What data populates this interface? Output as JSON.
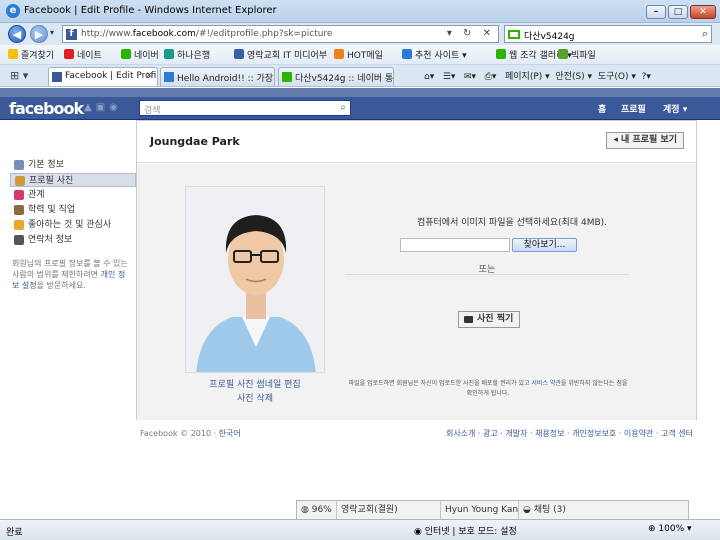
{
  "window": {
    "title": "Facebook | Edit Profile - Windows Internet Explorer",
    "min_label": "–",
    "max_label": "□",
    "close_label": "✕"
  },
  "address_bar": {
    "url_prefix": "http://www.",
    "url_domain": "facebook.com",
    "url_rest": "/#!/editprofile.php?sk=picture",
    "search_value": "다산v5424g"
  },
  "favorites_bar": {
    "label": "즐겨찾기",
    "items": [
      {
        "label": "네이트",
        "color": "#e02020"
      },
      {
        "label": "네이버",
        "color": "#2db400"
      },
      {
        "label": "하나은행",
        "color": "#1a9a8a"
      },
      {
        "label": "영락교회 IT 미디어부",
        "color": "#3a5fa8"
      },
      {
        "label": "HOT메일",
        "color": "#f07f1c"
      },
      {
        "label": "추천 사이트 ▾",
        "color": "#2d7bd6"
      },
      {
        "label": "웹 조각 갤러리 ▾",
        "color": "#2db400"
      },
      {
        "label": "빅파일",
        "color": "#5aa02c"
      }
    ]
  },
  "tabs": [
    {
      "label": "Facebook | Edit Profile",
      "active": true
    },
    {
      "label": "Hello Android!! :: 가장 ...",
      "active": false
    },
    {
      "label": "다산v5424g :: 네이버 통...",
      "active": false
    }
  ],
  "ie_command_bar": {
    "page_label": "페이지(P) ▾",
    "safety_label": "안전(S) ▾",
    "tools_label": "도구(O) ▾"
  },
  "facebook": {
    "brand": "facebook",
    "brand_color": "#3b5998",
    "search_placeholder": "검색",
    "nav": {
      "home": "홈",
      "profile": "프로필",
      "account": "계정 ▾"
    },
    "left_nav": [
      {
        "label": "기본 정보",
        "active": false,
        "color": "#7a8fb8"
      },
      {
        "label": "프로필 사진",
        "active": true,
        "color": "#c89b3c"
      },
      {
        "label": "관계",
        "active": false,
        "color": "#d23a6a"
      },
      {
        "label": "학력 및 직업",
        "active": false,
        "color": "#8a6a3e"
      },
      {
        "label": "좋아하는 것 및 관심사",
        "active": false,
        "color": "#e8a92a"
      },
      {
        "label": "연락처 정보",
        "active": false,
        "color": "#555555"
      }
    ],
    "privacy_note_pre": "회원님의 프로필 정보를 볼 수 있는 사람의 범위를 제한하려면 ",
    "privacy_note_link": "개인 정보 설정",
    "privacy_note_post": "을 방문하세요.",
    "profile_name": "Joungdae Park",
    "view_profile_button": "◂ 내 프로필 보기",
    "photo_links": {
      "edit_thumbnail": "프로필 사진 썸네일 편집",
      "delete": "사진 삭제"
    },
    "upload": {
      "instruction": "컴퓨터에서 이미지 파일을 선택하세요(최대 4MB).",
      "browse_button": "찾아보기...",
      "or_text": "또는",
      "take_photo_button": "사진 찍기",
      "terms_pre": "파일을 업로드하면 회원님은 자신이 업로드한 사진을 배포할 권리가 있고 ",
      "terms_link": "서비스 약관",
      "terms_post": "을 위반하지 않는다는 점을 확인하게 됩니다."
    },
    "footer": {
      "copyright": "Facebook © 2010 · ",
      "language": "한국어",
      "links": "회사소개 · 광고 · 개발자 · 채용정보 · 개인정보보호 · 이용약관 · 고객 센터"
    },
    "chatbar": {
      "percent": "96%",
      "church": "영락교회(결원)",
      "friend": "Hyun Young Kang ○",
      "chat": "채팅 (3)"
    }
  },
  "statusbar": {
    "text": "완료",
    "zone": "인터넷 | 보호 모드: 설정",
    "zoom": "100% ▾"
  }
}
